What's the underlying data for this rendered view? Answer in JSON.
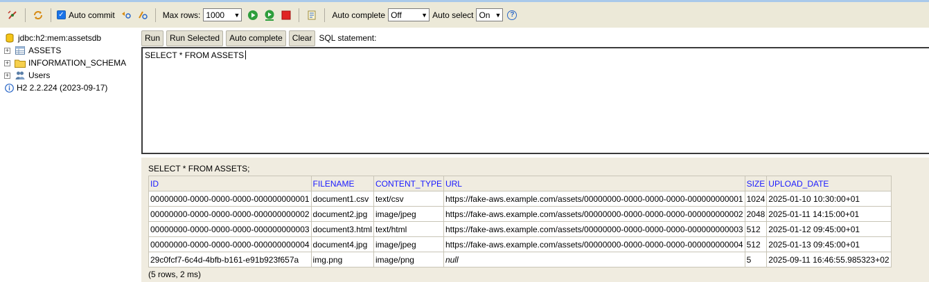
{
  "toolbar": {
    "auto_commit_label": "Auto commit",
    "max_rows_label": "Max rows:",
    "max_rows_value": "1000",
    "auto_complete_label": "Auto complete",
    "auto_complete_value": "Off",
    "auto_select_label": "Auto select",
    "auto_select_value": "On",
    "help_symbol": "?"
  },
  "tree": {
    "connection": "jdbc:h2:mem:assetsdb",
    "items": [
      {
        "label": "ASSETS"
      },
      {
        "label": "INFORMATION_SCHEMA"
      },
      {
        "label": "Users"
      }
    ],
    "version": "H2 2.2.224 (2023-09-17)"
  },
  "sql": {
    "buttons": [
      "Run",
      "Run Selected",
      "Auto complete",
      "Clear"
    ],
    "statement_label": "SQL statement:",
    "text": "SELECT * FROM ASSETS"
  },
  "results": {
    "query": "SELECT * FROM ASSETS;",
    "columns": [
      "ID",
      "FILENAME",
      "CONTENT_TYPE",
      "URL",
      "SIZE",
      "UPLOAD_DATE"
    ],
    "rows": [
      [
        "00000000-0000-0000-0000-000000000001",
        "document1.csv",
        "text/csv",
        "https://fake-aws.example.com/assets/00000000-0000-0000-0000-000000000001",
        "1024",
        "2025-01-10 10:30:00+01"
      ],
      [
        "00000000-0000-0000-0000-000000000002",
        "document2.jpg",
        "image/jpeg",
        "https://fake-aws.example.com/assets/00000000-0000-0000-0000-000000000002",
        "2048",
        "2025-01-11 14:15:00+01"
      ],
      [
        "00000000-0000-0000-0000-000000000003",
        "document3.html",
        "text/html",
        "https://fake-aws.example.com/assets/00000000-0000-0000-0000-000000000003",
        "512",
        "2025-01-12 09:45:00+01"
      ],
      [
        "00000000-0000-0000-0000-000000000004",
        "document4.jpg",
        "image/jpeg",
        "https://fake-aws.example.com/assets/00000000-0000-0000-0000-000000000004",
        "512",
        "2025-01-13 09:45:00+01"
      ],
      [
        "29c0fcf7-6c4d-4bfb-b161-e91b923f657a",
        "img.png",
        "image/png",
        "null",
        "5",
        "2025-09-11 16:46:55.985323+02"
      ]
    ],
    "footer": "(5 rows, 2 ms)"
  },
  "colors": {
    "toolbar_bg": "#ece9d8",
    "header_text": "#1a1aff",
    "results_bg": "#f0ece0"
  }
}
